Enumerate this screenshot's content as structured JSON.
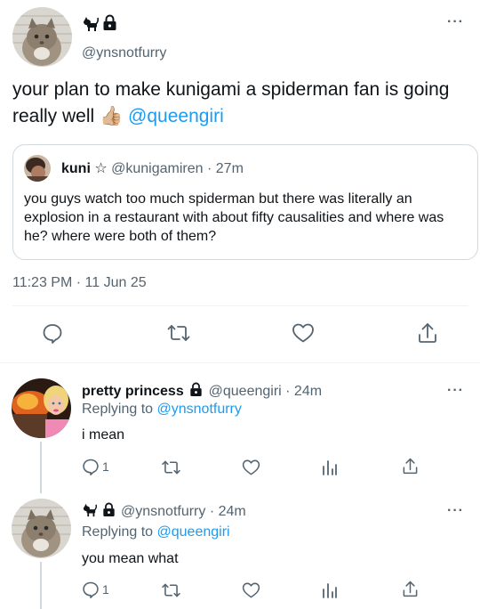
{
  "main_tweet": {
    "handle": "@ynsnotfurry",
    "name_icons": [
      "cat-icon",
      "lock-icon"
    ],
    "text_prefix": "your plan to make kunigami a spiderman fan is going really well ",
    "emoji": "👍🏼",
    "mention": "@queengiri",
    "timestamp": "11:23 PM · 11 Jun 25"
  },
  "quoted_tweet": {
    "name": "kuni ☆",
    "handle": "@kunigamiren",
    "time": "· 27m",
    "text": "you guys watch too much spiderman but there was literally an explosion in a restaurant with about fifty causalities and where was he? where were both of them?"
  },
  "replies": [
    {
      "name": "pretty princess",
      "handle": "@queengiri",
      "time": "· 24m",
      "replying_to_label": "Replying to",
      "replying_to": "@ynsnotfurry",
      "text": "i mean",
      "reply_count": "1"
    },
    {
      "name": "",
      "handle": "@ynsnotfurry",
      "time": "· 24m",
      "replying_to_label": "Replying to",
      "replying_to": "@queengiri",
      "text": "you mean what",
      "reply_count": "1"
    }
  ],
  "more_icon": "···",
  "colors": {
    "accent": "#1d9bf0",
    "muted": "#536471",
    "border": "#cfd9de",
    "text": "#0f1419"
  }
}
